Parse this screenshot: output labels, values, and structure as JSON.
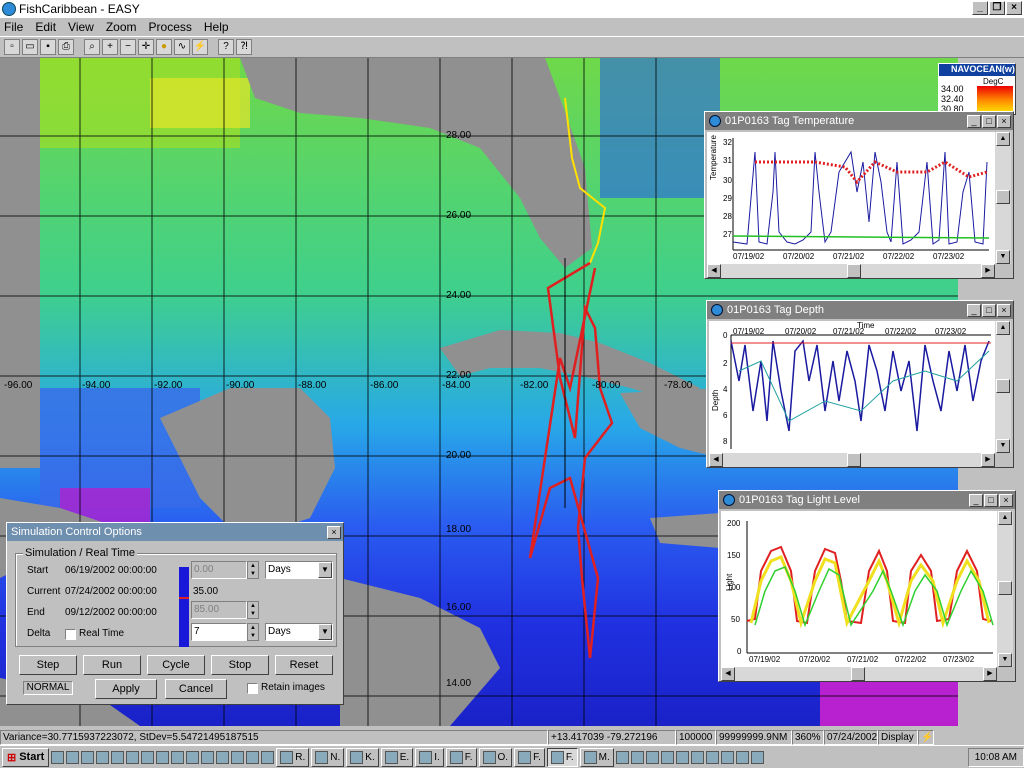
{
  "app": {
    "title": "FishCaribbean - EASY"
  },
  "menu": [
    "File",
    "Edit",
    "View",
    "Zoom",
    "Process",
    "Help"
  ],
  "map": {
    "lat_labels": [
      "28.00",
      "26.00",
      "24.00",
      "22.00",
      "20.00",
      "18.00",
      "16.00",
      "14.00"
    ],
    "lon_labels": [
      "-96.00",
      "-94.00",
      "-92.00",
      "-90.00",
      "-88.00",
      "-86.00",
      "-84.00",
      "-82.00",
      "-80.00",
      "-78.00"
    ]
  },
  "legend": {
    "title": "NAVOCEAN(w)",
    "unit": "DegC",
    "values": [
      "34.00",
      "32.40",
      "30.80"
    ]
  },
  "temp_window": {
    "title": "01P0163 Tag Temperature",
    "ylabel": "Temperature",
    "yticks": [
      "32",
      "31",
      "30",
      "29",
      "28",
      "27"
    ],
    "xticks": [
      "07/19/02",
      "07/20/02",
      "07/21/02",
      "07/22/02",
      "07/23/02"
    ]
  },
  "depth_window": {
    "title": "01P0163 Tag Depth",
    "ylabel": "Depth",
    "xlabel": "Time",
    "yticks": [
      "0",
      "2",
      "4",
      "6",
      "8"
    ],
    "xticks": [
      "07/19/02",
      "07/20/02",
      "07/21/02",
      "07/22/02",
      "07/23/02"
    ]
  },
  "light_window": {
    "title": "01P0163 Tag Light Level",
    "ylabel": "Light",
    "yticks": [
      "200",
      "150",
      "100",
      "50",
      "0"
    ],
    "xticks": [
      "07/19/02",
      "07/20/02",
      "07/21/02",
      "07/22/02",
      "07/23/02"
    ]
  },
  "sim": {
    "title": "Simulation Control Options",
    "group": "Simulation / Real Time",
    "start_label": "Start",
    "start_value": "06/19/2002 00:00:00",
    "current_label": "Current",
    "current_value": "07/24/2002 00:00:00",
    "end_label": "End",
    "end_value": "09/12/2002 00:00:00",
    "delta_label": "Delta",
    "realtime_label": "Real Time",
    "start_num": "0.00",
    "current_num": "35.00",
    "end_num": "85.00",
    "delta_num": "7",
    "unit1": "Days",
    "unit2": "Days",
    "buttons": {
      "step": "Step",
      "run": "Run",
      "cycle": "Cycle",
      "stop": "Stop",
      "reset": "Reset"
    },
    "mode": "NORMAL",
    "apply": "Apply",
    "cancel": "Cancel",
    "retain": "Retain images"
  },
  "status": {
    "variance": "Variance=30.7715937223072, StDev=5.54721495187515",
    "coords": "+13.417039 -79.272196",
    "scale": "100000",
    "range": "99999999.9NM",
    "heading": "360%",
    "date": "07/24/2002",
    "mode": "Display"
  },
  "taskbar": {
    "start": "Start",
    "tasks": [
      "R.",
      "N.",
      "K.",
      "E.",
      "I.",
      "F.",
      "O.",
      "F.",
      "F.",
      "M."
    ],
    "clock": "10:08 AM"
  }
}
